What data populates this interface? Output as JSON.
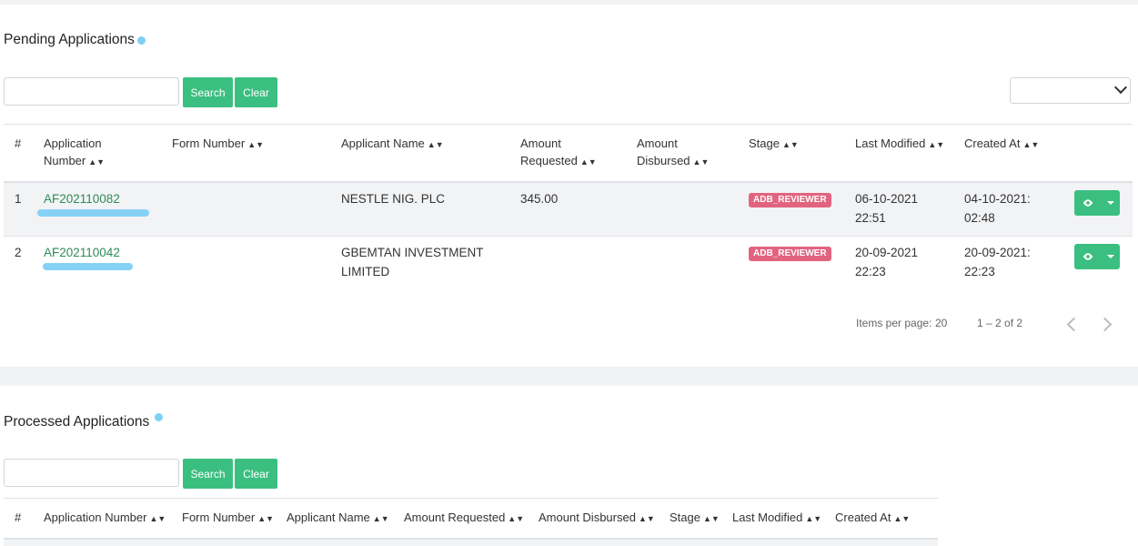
{
  "pending": {
    "title": "Pending Applications",
    "search_label": "Search",
    "clear_label": "Clear",
    "columns": [
      "#",
      "Application",
      "Number",
      "Form Number",
      "Applicant Name",
      "Amount",
      "Requested",
      "Amount",
      "Disbursed",
      "Stage",
      "Last Modified",
      "Created At"
    ],
    "rows": [
      {
        "idx": "1",
        "app_no": "AF202110082",
        "applicant": "NESTLE NIG. PLC",
        "applicant2": "",
        "amount": "345.00",
        "stage": "ADB_REVIEWER",
        "modified_date": "06-10-2021",
        "modified_time": "22:51",
        "created_date": "04-10-2021:",
        "created_time": "02:48"
      },
      {
        "idx": "2",
        "app_no": "AF202110042",
        "applicant": "GBEMTAN INVESTMENT",
        "applicant2": "LIMITED",
        "amount": "",
        "stage": "ADB_REVIEWER",
        "modified_date": "20-09-2021",
        "modified_time": "22:23",
        "created_date": "20-09-2021:",
        "created_time": "22:23"
      }
    ],
    "paginator": {
      "items_per_page": "Items per page:",
      "page_size": "20",
      "range": "1 – 2 of 2"
    }
  },
  "processed": {
    "title": "Processed Applications",
    "search_label": "Search",
    "clear_label": "Clear",
    "columns": [
      "#",
      "Application Number",
      "Form Number",
      "Applicant Name",
      "Amount Requested",
      "Amount Disbursed",
      "Stage",
      "Last Modified",
      "Created At"
    ]
  },
  "colors": {
    "accent": "#3bbf80",
    "link": "#2e8b57",
    "badge": "#e2637f",
    "highlight": "#7fd0f7"
  }
}
